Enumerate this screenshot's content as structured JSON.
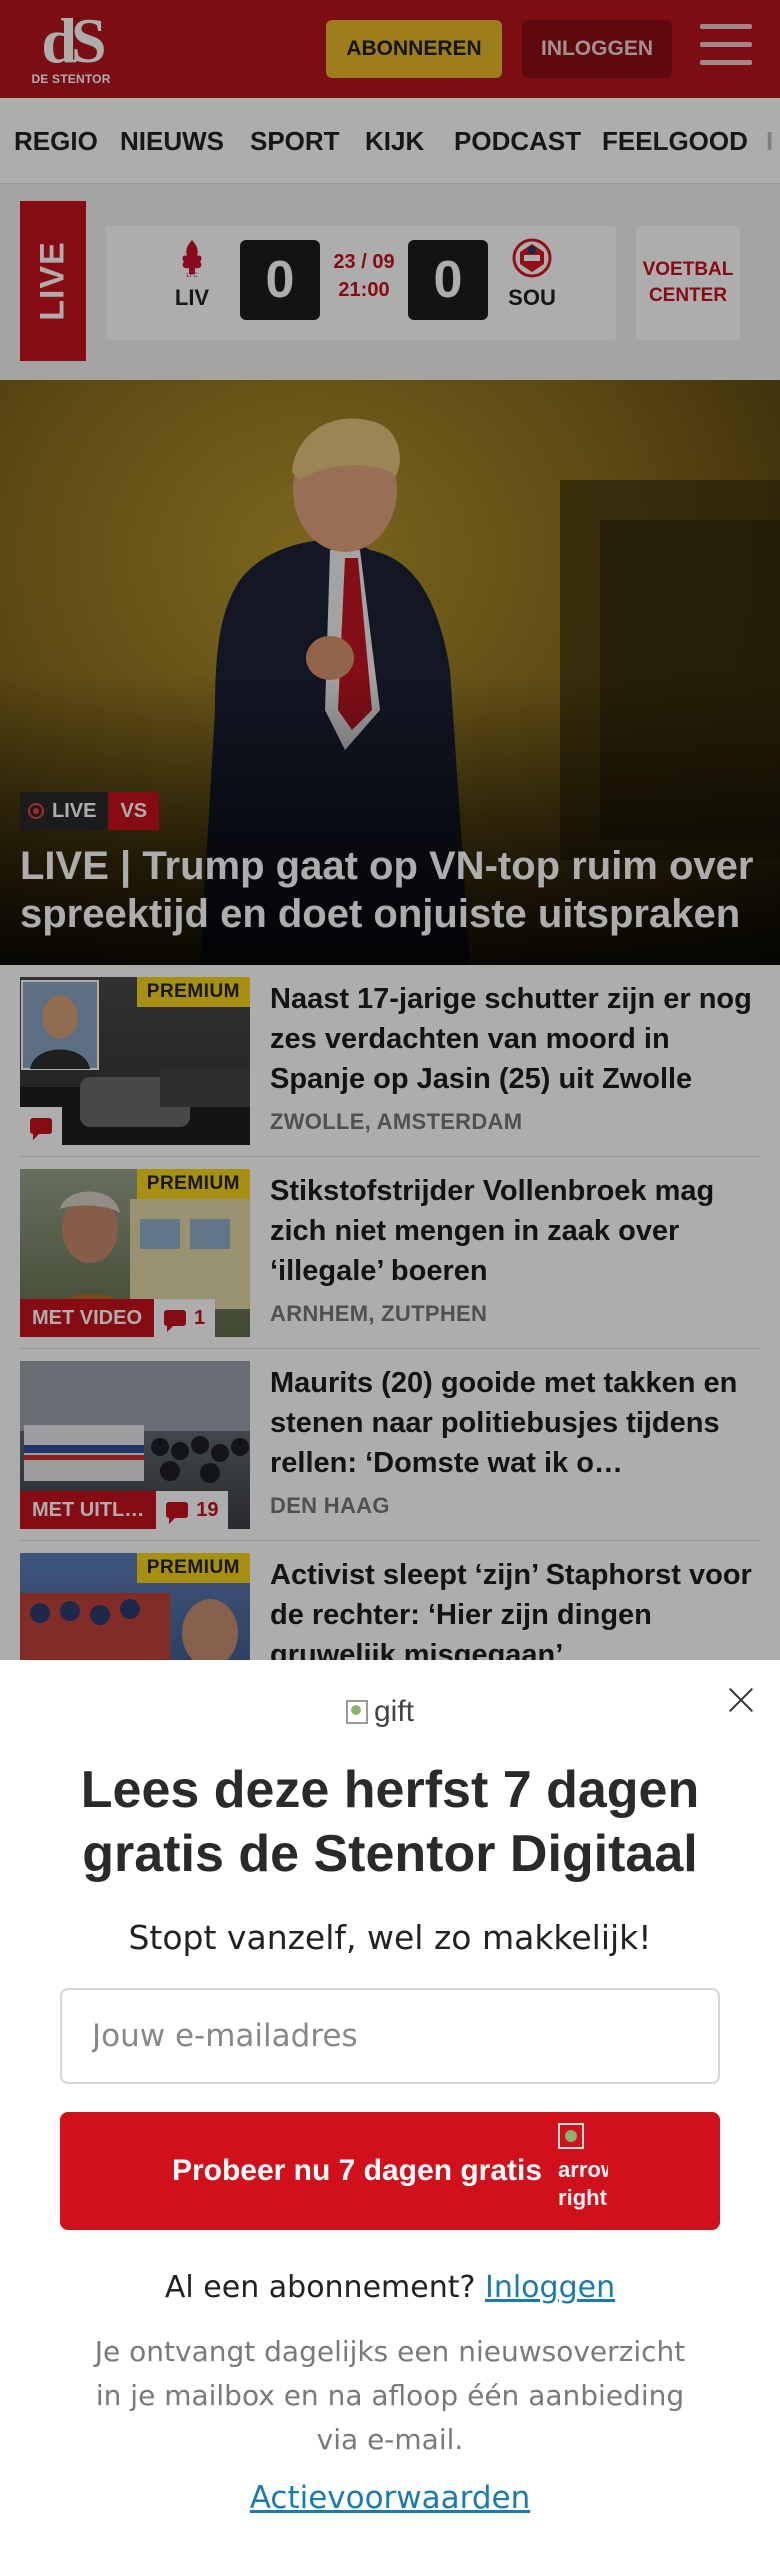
{
  "header": {
    "logo_mark": "dS",
    "logo_text": "DE STENTOR",
    "subscribe_label": "ABONNEREN",
    "login_label": "INLOGGEN"
  },
  "nav": {
    "items": [
      "REGIO",
      "NIEUWS",
      "SPORT",
      "KIJK",
      "PODCAST",
      "FEELGOOD",
      "I"
    ]
  },
  "live_match": {
    "live_label": "LIVE",
    "home_team": "LIV",
    "away_team": "SOU",
    "home_score": "0",
    "away_score": "0",
    "date": "23 / 09",
    "time": "21:00",
    "voetbal_center_label": "VOETBAL CENTER",
    "home_color": "#c8102e",
    "away_color": "#d71920"
  },
  "hero": {
    "live_badge": "LIVE",
    "category_badge": "VS",
    "title": "LIVE | Trump gaat op VN-top ruim over spreektijd en doet onjuiste uitspraken"
  },
  "articles": [
    {
      "title": "Naast 17-jarige schutter zijn er nog zes verdachten van moord in Spanje op Jasin (25) uit Zwolle",
      "location": "ZWOLLE, AMSTERDAM",
      "premium": "PREMIUM",
      "video_label": "",
      "comments": ""
    },
    {
      "title": "Stikstofstrijder Vollenbroek mag zich niet mengen in zaak over ‘illegale’ boeren",
      "location": "ARNHEM, ZUTPHEN",
      "premium": "PREMIUM",
      "video_label": "MET VIDEO",
      "comments": "1"
    },
    {
      "title": "Maurits (20) gooide met takken en stenen naar politiebusjes tijdens rellen: ‘Domste wat ik o…",
      "location": "DEN HAAG",
      "premium": "",
      "video_label": "MET UITL…",
      "comments": "19"
    },
    {
      "title": "Activist sleept ‘zijn’ Staphorst voor de rechter: ‘Hier zijn dingen gruwelijk misgegaan’",
      "location": "",
      "premium": "PREMIUM",
      "video_label": "",
      "comments": ""
    }
  ],
  "modal": {
    "gift_alt": "gift",
    "title": "Lees deze herfst 7 dagen gratis de Stentor Digitaal",
    "subtitle": "Stopt vanzelf, wel zo makkelijk!",
    "email_placeholder": "Jouw e-mailadres",
    "cta_label": "Probeer nu 7 dagen gratis",
    "cta_icon_alt": "arrow-right",
    "login_prompt": "Al een abonnement?",
    "login_link": "Inloggen",
    "info": "Je ontvangt dagelijks een nieuwsoverzicht in je mailbox en na afloop één aanbieding via e-mail.",
    "terms_link": "Actievoorwaarden"
  },
  "colors": {
    "brand": "#b4151d",
    "subscribe": "#e8b82a",
    "premium": "#f7d31a",
    "cta": "#d0101a",
    "link": "#1b7bb0"
  }
}
